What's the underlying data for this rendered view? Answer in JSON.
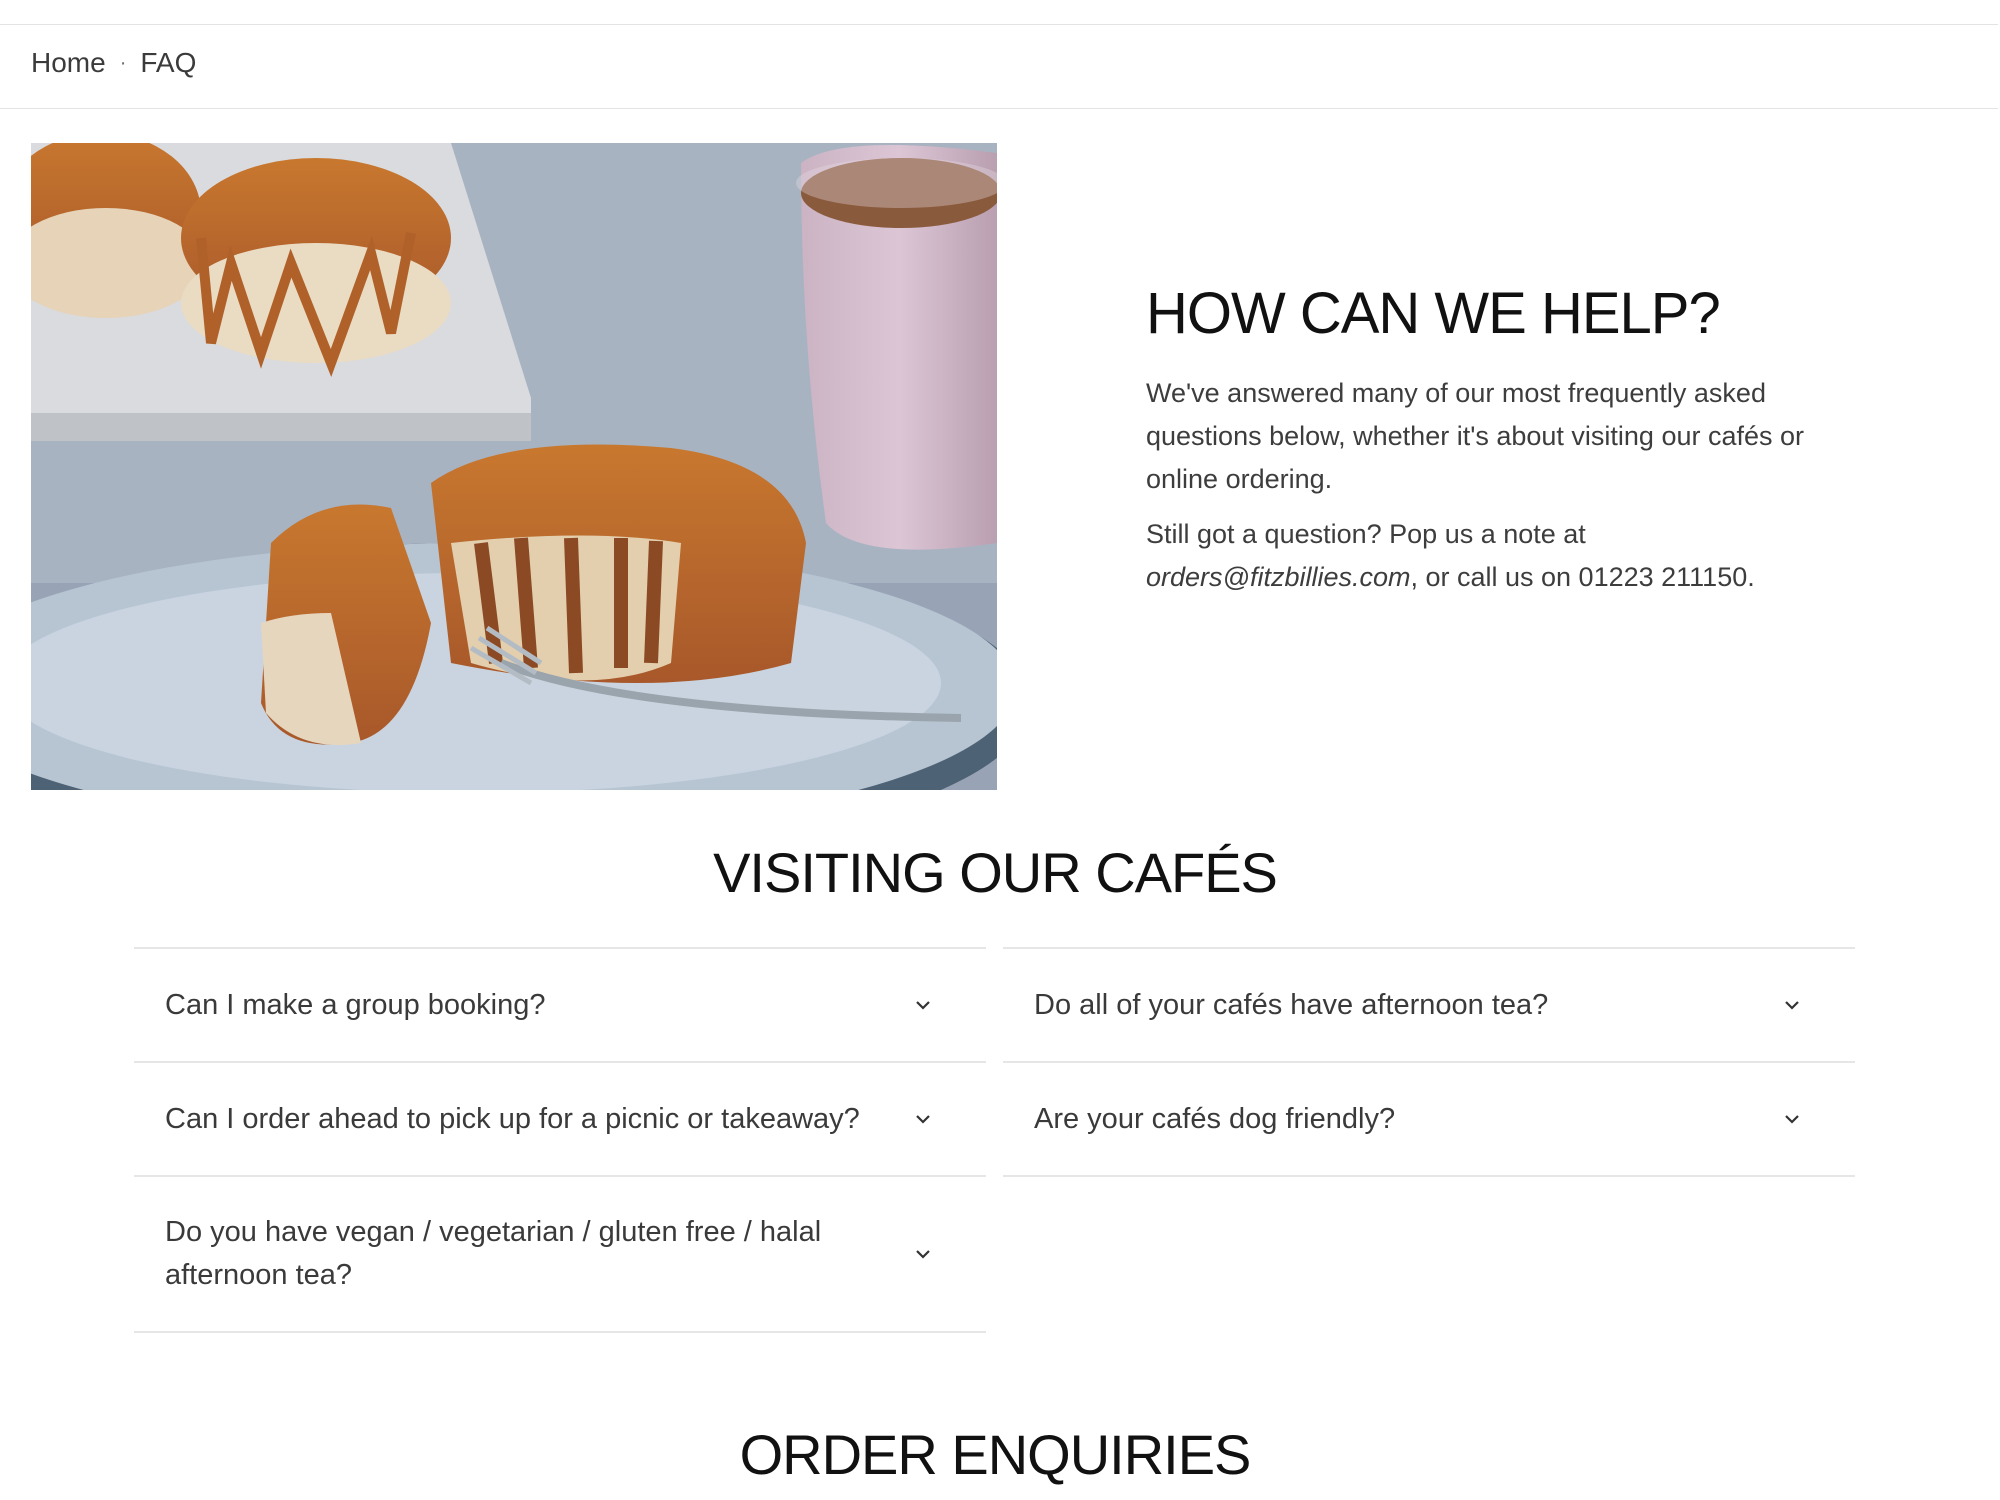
{
  "breadcrumb": {
    "home": "Home",
    "separator": "·",
    "current": "FAQ"
  },
  "hero": {
    "title": "HOW CAN WE HELP?",
    "paragraph": "We've answered many of our most frequently asked questions below, whether it's about visiting our cafés or online ordering.",
    "contact_prefix": "Still got a question? Pop us a note at ",
    "email": "orders@fitzbillies.com",
    "contact_suffix": ", or call us on 01223 211150."
  },
  "sections": {
    "visiting_title": "VISITING OUR CAFÉS",
    "orders_title": "ORDER ENQUIRIES"
  },
  "faq_left": [
    {
      "question": "Can I make a group booking?"
    },
    {
      "question": "Can I order ahead to pick up for a picnic or takeaway?"
    },
    {
      "question": "Do you have vegan / vegetarian / gluten free / halal afternoon tea?"
    }
  ],
  "faq_right": [
    {
      "question": "Do all of your cafés have afternoon tea?"
    },
    {
      "question": "Are your cafés dog friendly?"
    }
  ],
  "icons": {
    "expand": "chevron-down-icon"
  }
}
